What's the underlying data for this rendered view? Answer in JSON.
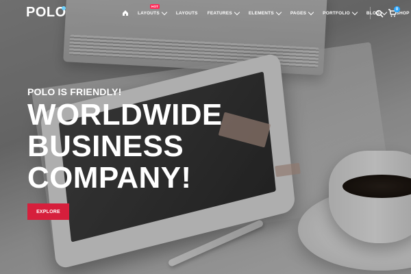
{
  "brand": {
    "logo_text": "POLO",
    "accent_dot_color": "#6fd3ff"
  },
  "nav": {
    "items": [
      {
        "label": "LAYOUTS",
        "badge": "HOT"
      },
      {
        "label": "LAYOUTS"
      },
      {
        "label": "FEATURES"
      },
      {
        "label": "ELEMENTS"
      },
      {
        "label": "PAGES"
      },
      {
        "label": "PORTFOLIO"
      },
      {
        "label": "BLOG"
      },
      {
        "label": "SHOP"
      }
    ],
    "cart_count": "0",
    "icons": {
      "home": "home-icon",
      "search": "search-icon",
      "cart": "cart-icon",
      "dropdown": "chevron-down-icon"
    }
  },
  "hero": {
    "kicker": "POLO IS FRIENDLY!",
    "headline_lines": [
      "WORLDWIDE",
      "BUSINESS",
      "COMPANY!"
    ],
    "cta_label": "EXPLORE",
    "cta_color": "#d61f3c"
  }
}
